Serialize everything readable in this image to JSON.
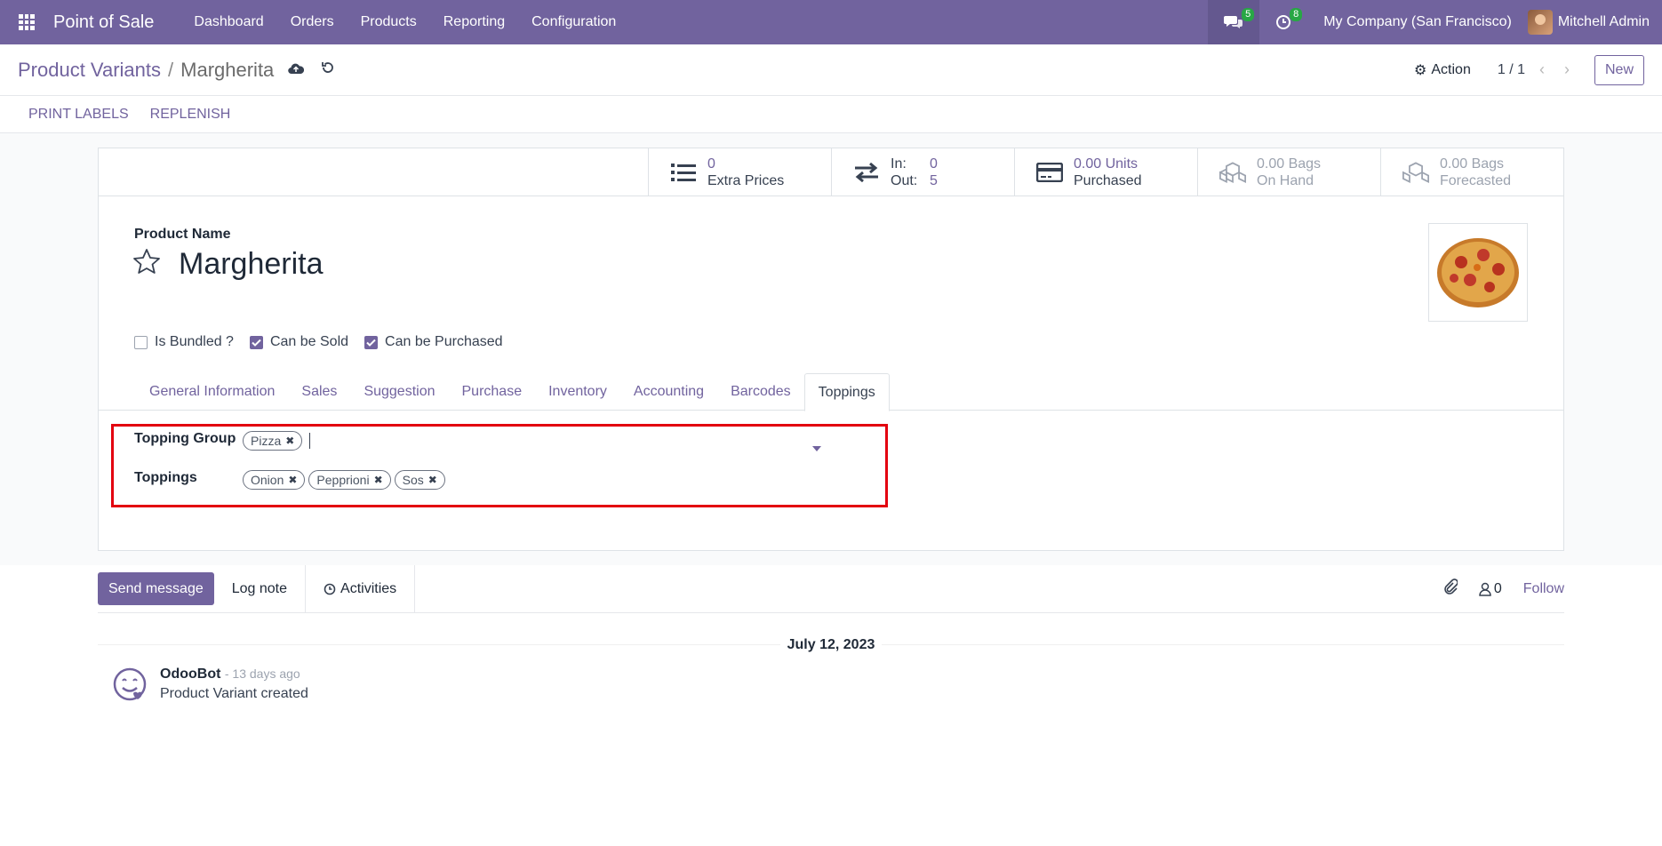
{
  "navbar": {
    "brand": "Point of Sale",
    "menu": [
      "Dashboard",
      "Orders",
      "Products",
      "Reporting",
      "Configuration"
    ],
    "messages_count": "5",
    "activities_count": "8",
    "company": "My Company (San Francisco)",
    "user": "Mitchell Admin"
  },
  "control_panel": {
    "breadcrumb_parent": "Product Variants",
    "breadcrumb_sep": "/",
    "breadcrumb_current": "Margherita",
    "action_label": "Action",
    "pager": "1 / 1",
    "new_label": "New"
  },
  "header_actions": [
    "PRINT LABELS",
    "REPLENISH"
  ],
  "smart_buttons": {
    "extra_prices_value": "0",
    "extra_prices_label": "Extra Prices",
    "in_label": "In:",
    "in_value": "0",
    "out_label": "Out:",
    "out_value": "5",
    "purchased_value": "0.00 Units",
    "purchased_label": "Purchased",
    "on_hand_value": "0.00 Bags",
    "on_hand_label": "On Hand",
    "forecasted_value": "0.00 Bags",
    "forecasted_label": "Forecasted"
  },
  "form": {
    "product_name_label": "Product Name",
    "product_name": "Margherita",
    "checkboxes": [
      {
        "label": "Is Bundled ?",
        "checked": false
      },
      {
        "label": "Can be Sold",
        "checked": true
      },
      {
        "label": "Can be Purchased",
        "checked": true
      }
    ],
    "tabs": [
      "General Information",
      "Sales",
      "Suggestion",
      "Purchase",
      "Inventory",
      "Accounting",
      "Barcodes",
      "Toppings"
    ],
    "active_tab": "Toppings",
    "topping_group_label": "Topping Group",
    "topping_group_tags": [
      "Pizza"
    ],
    "toppings_label": "Toppings",
    "toppings_tags": [
      "Onion",
      "Pepprioni",
      "Sos"
    ]
  },
  "chatter": {
    "send_message": "Send message",
    "log_note": "Log note",
    "activities": "Activities",
    "followers_count": "0",
    "follow": "Follow",
    "date": "July 12, 2023",
    "message": {
      "author": "OdooBot",
      "time": "- 13 days ago",
      "body": "Product Variant created"
    }
  },
  "colors": {
    "brand": "#71639e",
    "highlight": "#e3000f",
    "badge": "#28a745"
  }
}
